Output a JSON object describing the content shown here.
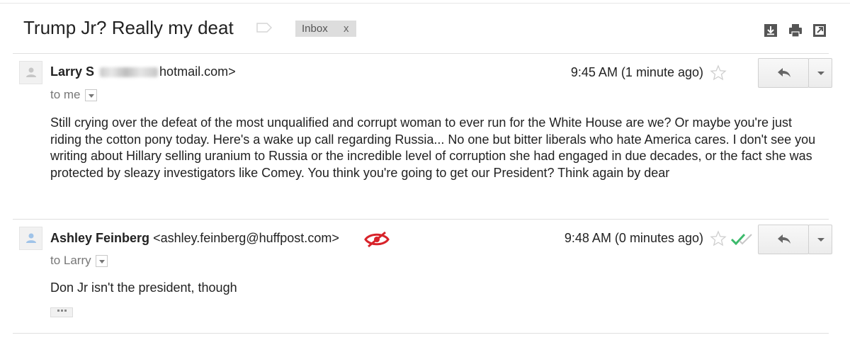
{
  "toolbar": {
    "subject": "Trump Jr? Really my deat",
    "label_chip": "Inbox",
    "label_remove": "x",
    "icons": [
      "download-icon",
      "print-icon",
      "new-window-icon"
    ]
  },
  "messages": [
    {
      "sender_name": "Larry S",
      "sender_email": "hotmail.com>",
      "recipient": "to me",
      "time": "9:45 AM (1 minute ago)",
      "body": "Still crying over the defeat of the most unqualified and corrupt woman to ever run for the White House are we? Or maybe you're just riding the cotton pony today. Here's a wake up call regarding Russia... No one but bitter liberals who hate America cares. I don't see you writing about Hillary selling uranium to Russia or the incredible level of corruption she had engaged in due decades, or the fact she was protected by sleazy investigators like Comey. You think you're going to get our President? Think again by dear"
    },
    {
      "sender_name": "Ashley Feinberg",
      "sender_email": "<ashley.feinberg@huffpost.com>",
      "recipient": "to Larry",
      "time": "9:48 AM (0 minutes ago)",
      "body": "Don Jr isn't the president, though"
    }
  ],
  "colors": {
    "tracker_icon": "#d8232a",
    "read_check": "#3bba6b",
    "avatar_glyph_1": "#bdbdbd",
    "avatar_glyph_2": "#9fc3e8"
  }
}
